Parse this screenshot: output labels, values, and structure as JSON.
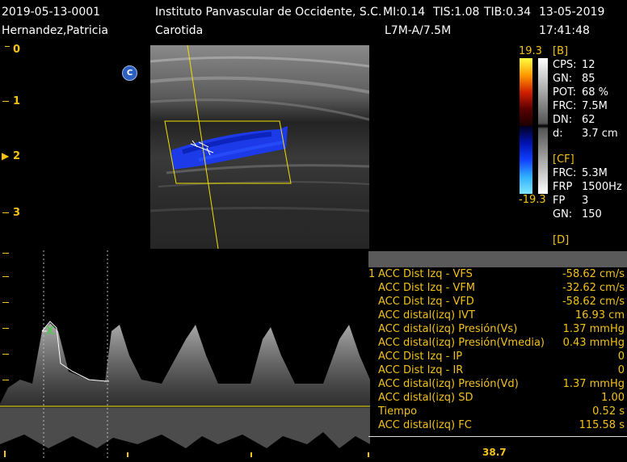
{
  "header": {
    "patient_id": "2019-05-13-0001",
    "patient_name": "Hernandez,Patricia",
    "institution": "Instituto Panvascular de Occidente, S.C.",
    "mi": "MI:0.14",
    "tis": "TIS:1.08",
    "tib": "TIB:0.34",
    "date": "13-05-2019",
    "exam": "Carotida",
    "probe": "L7M-A/7.5M",
    "time": "17:41:48"
  },
  "depth_scale": [
    "0",
    "1",
    "2",
    "3"
  ],
  "marker_c": "C",
  "color_bar": {
    "max": "19.3",
    "min": "-19.3"
  },
  "params": {
    "b_header": "[B]",
    "b": [
      {
        "k": "CPS:",
        "v": "12"
      },
      {
        "k": "GN:",
        "v": "85"
      },
      {
        "k": "POT:",
        "v": "68 %"
      },
      {
        "k": "FRC:",
        "v": "7.5M"
      },
      {
        "k": "DN:",
        "v": "62"
      },
      {
        "k": "d:",
        "v": "3.7 cm"
      }
    ],
    "cf_header": "[CF]",
    "cf": [
      {
        "k": "FRC:",
        "v": "5.3M"
      },
      {
        "k": "FRP",
        "v": "1500Hz"
      },
      {
        "k": "FP",
        "v": "3"
      },
      {
        "k": "GN:",
        "v": "150"
      }
    ],
    "d_header": "[D]"
  },
  "measurements": [
    {
      "n": "1",
      "label": "ACC Dist Izq - VFS",
      "value": "-58.62 cm/s"
    },
    {
      "n": "",
      "label": "ACC Dist Izq - VFM",
      "value": "-32.62 cm/s"
    },
    {
      "n": "",
      "label": "ACC Dist Izq - VFD",
      "value": "-58.62 cm/s"
    },
    {
      "n": "",
      "label": "ACC distal(izq) IVT",
      "value": "16.93 cm"
    },
    {
      "n": "",
      "label": "ACC distal(izq) Presión(Vs)",
      "value": "1.37 mmHg"
    },
    {
      "n": "",
      "label": "ACC distal(izq) Presión(Vmedia)",
      "value": "0.43 mmHg"
    },
    {
      "n": "",
      "label": "ACC Dist Izq - IP",
      "value": "0"
    },
    {
      "n": "",
      "label": "ACC Dist Izq - IR",
      "value": "0"
    },
    {
      "n": "",
      "label": "ACC distal(izq) Presión(Vd)",
      "value": "1.37 mmHg"
    },
    {
      "n": "",
      "label": "ACC distal(izq) SD",
      "value": "1.00"
    },
    {
      "n": "",
      "label": "Tiempo",
      "value": "0.52 s"
    },
    {
      "n": "",
      "label": "ACC distal(izq) FC",
      "value": "115.58 s"
    }
  ],
  "doppler": {
    "bottom_value": "38.7"
  },
  "colors": {
    "annotation": "#f2c21a",
    "flow": "#1030e0",
    "background": "#000000"
  }
}
